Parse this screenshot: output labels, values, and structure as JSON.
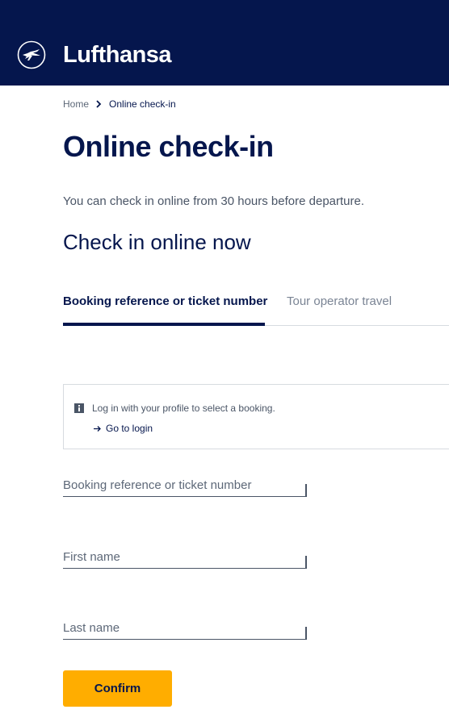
{
  "header": {
    "brand": "Lufthansa",
    "background": "#05164d",
    "logo_icon": "crane-logo-icon"
  },
  "breadcrumb": {
    "home": "Home",
    "separator_icon": "chevron-right-icon",
    "current": "Online check-in"
  },
  "page": {
    "title": "Online check-in",
    "info": "You can check in online from 30 hours before departure.",
    "section_title": "Check in online now"
  },
  "tabs": [
    {
      "label": "Booking reference or ticket number",
      "active": true
    },
    {
      "label": "Tour operator travel",
      "active": false
    }
  ],
  "login_notice": {
    "icon": "info-icon",
    "message": "Log in with your profile to select a booking.",
    "link_icon": "arrow-right-icon",
    "link_label": "Go to login"
  },
  "form": {
    "booking_placeholder": "Booking reference or ticket number",
    "first_name_placeholder": "First name",
    "last_name_placeholder": "Last name",
    "confirm_label": "Confirm"
  },
  "colors": {
    "primary": "#05164d",
    "accent": "#ffad00"
  }
}
